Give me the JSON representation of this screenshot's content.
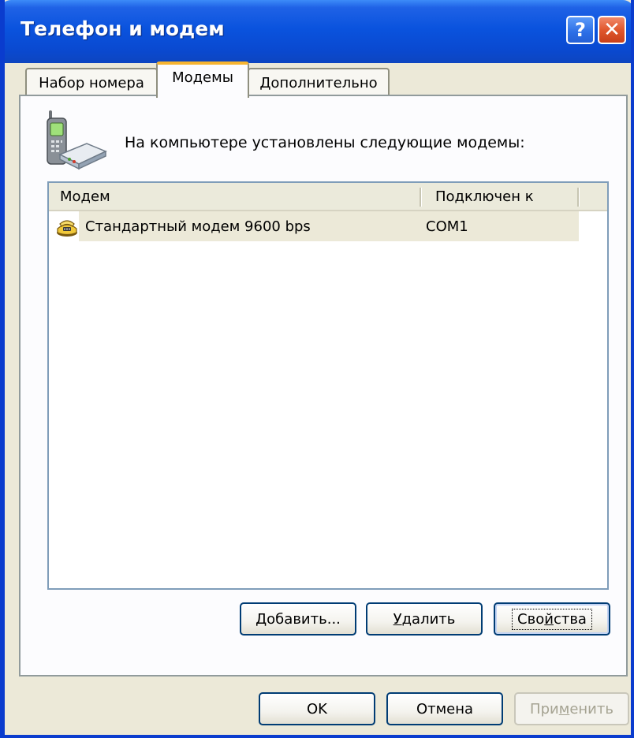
{
  "window": {
    "title": "Телефон и модем"
  },
  "titlebar": {
    "help_label": "?",
    "close_label": "✕"
  },
  "tabs": [
    {
      "label": "Набор номера",
      "active": false
    },
    {
      "label": "Модемы",
      "active": true
    },
    {
      "label": "Дополнительно",
      "active": false
    }
  ],
  "panel": {
    "intro": {
      "before": "На компьютере установлены следующие мо",
      "underlined": "д",
      "after": "емы:"
    },
    "icon": "phone-modem-icon"
  },
  "listview": {
    "columns": [
      "Модем",
      "Подключен к"
    ],
    "rows": [
      {
        "name": "Стандартный модем 9600 bps",
        "port": "COM1",
        "selected": true,
        "icon": "modem-icon"
      }
    ]
  },
  "buttons": {
    "add": {
      "mnemonic": "Д",
      "rest": "обавить..."
    },
    "remove": {
      "mnemonic": "У",
      "rest": "далить"
    },
    "properties": {
      "before": "Сво",
      "mnemonic": "й",
      "after": "ства"
    },
    "ok": "OK",
    "cancel": "Отмена",
    "apply": {
      "before": "При",
      "mnemonic": "м",
      "after": "енить",
      "disabled": true
    }
  },
  "colors": {
    "titlebar": "#0a53de",
    "face": "#ece9d8",
    "tab_highlight": "#f6b430",
    "button_border": "#003c74",
    "disabled_text": "#a5a392"
  }
}
